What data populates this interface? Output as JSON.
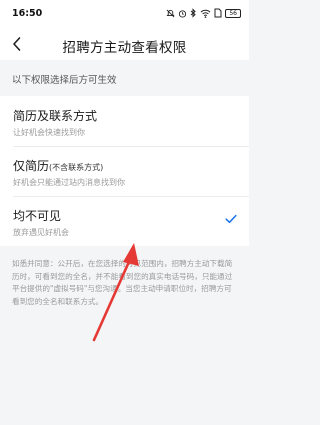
{
  "status_bar": {
    "time": "16:50",
    "battery": "56",
    "icons": [
      "notification-mute-icon",
      "alarm-icon",
      "bluetooth-icon",
      "wifi-icon",
      "sim-icon",
      "battery-icon"
    ]
  },
  "nav": {
    "back_icon": "chevron-left-icon",
    "title": "招聘方主动查看权限"
  },
  "hint": "以下权限选择后方可生效",
  "options": [
    {
      "title": "简历及联系方式",
      "title_suffix": "",
      "subtitle": "让好机会快速找到你",
      "selected": false
    },
    {
      "title": "仅简历",
      "title_suffix": "(不含联系方式)",
      "subtitle": "好机会只能通过站内消息找到你",
      "selected": false
    },
    {
      "title": "均不可见",
      "title_suffix": "",
      "subtitle": "放弃遇见好机会",
      "selected": true
    }
  ],
  "notice": "如悉并同意：公开后，在您选择的可见范围内，招聘方主动下载简历时，可看到您的全名，并不能看到您的真实电话号码，只能通过平台提供的\"虚拟号码\"与您沟通。当您主动申请职位时，招聘方可看到您的全名和联系方式。",
  "colors": {
    "accent": "#1a73e8",
    "arrow": "#e53935",
    "background": "#f4f5f7"
  }
}
